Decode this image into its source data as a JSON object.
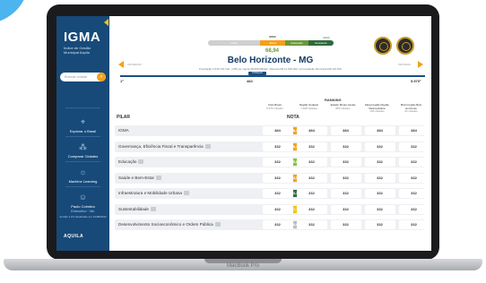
{
  "sidebar": {
    "logo": "IGMA",
    "subtitle": "Índice de Gestão Municipal Aquila",
    "search_placeholder": "Buscar cidade",
    "nav": [
      {
        "label": "Explorar o Brasil",
        "icon": "map-pin-icon",
        "glyph": "⌖"
      },
      {
        "label": "Comparar Cidades",
        "icon": "compare-icon",
        "glyph": "⁂"
      },
      {
        "label": "Machine Learning",
        "icon": "lightbulb-icon",
        "glyph": "☼"
      },
      {
        "label": "Paulo Coimbra",
        "sub": "Executivo · ML",
        "icon": "user-icon",
        "glyph": "☺"
      }
    ],
    "version": "Versão 1.0.0 Atualizado em 12/08/2022",
    "brand": "AQUILA"
  },
  "header": {
    "pill_title": "IGMA",
    "pill_marker": "IGMA",
    "pill_segments": [
      {
        "label": "Crítico",
        "color": "#cfcfcf"
      },
      {
        "label": "Alerta",
        "color": "#f2a11a"
      },
      {
        "label": "Adequado",
        "color": "#6a9a3a"
      },
      {
        "label": "Excelente",
        "color": "#2f6b3c"
      }
    ],
    "score": "68,94",
    "prev_label": "ANTERIOR",
    "next_label": "PRÓXIMA",
    "city": "Belo Horizonte - MG",
    "info": "População 2.530.701 hab.  |  PIB per capita 38.695 R$/hab  |  Receita R$ 11.530.000  |  Arrecadação Municipal R$ 123.500",
    "slider_label": "POSIÇÃO",
    "slider_min": "1º",
    "slider_pos": "484",
    "slider_max": "5.570º"
  },
  "table": {
    "ranking_label": "RANKING",
    "pilar_header": "PILAR",
    "nota_header": "NOTA",
    "columns": [
      {
        "title": "País Brasil",
        "sub": "5.570 cidades"
      },
      {
        "title": "Região Sudeste",
        "sub": "1.668 cidades"
      },
      {
        "title": "Estado Minas Gerais",
        "sub": "853 cidades"
      },
      {
        "title": "Mesorregião Região Metropolitana",
        "sub": "105 cidades"
      },
      {
        "title": "Microrregião Belo Horizonte",
        "sub": "24 cidades"
      }
    ],
    "rows": [
      {
        "label": "IGMA",
        "score": "68,4",
        "color": "#f2a11a",
        "ranks": [
          "484",
          "484",
          "484",
          "484",
          "484"
        ]
      },
      {
        "label": "Governança, Eficiência Fiscal e Transparência",
        "score": "66,3",
        "color": "#f2a11a",
        "ranks": [
          "332",
          "332",
          "332",
          "332",
          "332"
        ]
      },
      {
        "label": "Educação",
        "score": "70,6",
        "color": "#8cbf3f",
        "ranks": [
          "332",
          "332",
          "332",
          "332",
          "332"
        ]
      },
      {
        "label": "Saúde e Bem-Estar",
        "score": "64,5",
        "color": "#f2a11a",
        "ranks": [
          "332",
          "332",
          "332",
          "332",
          "332"
        ]
      },
      {
        "label": "Infraestrutura e Mobilidade Urbana",
        "score": "83,3",
        "color": "#2f6b3c",
        "ranks": [
          "332",
          "332",
          "332",
          "332",
          "332"
        ]
      },
      {
        "label": "Sustentabilidade",
        "score": "57,1",
        "color": "#f2c318",
        "ranks": [
          "332",
          "332",
          "332",
          "332",
          "332"
        ]
      },
      {
        "label": "Desenvolvimento Socioeconômico e Ordem Pública",
        "score": "48,8",
        "color": "#b9bcc2",
        "ranks": [
          "332",
          "332",
          "332",
          "332",
          "332"
        ]
      }
    ]
  },
  "device": {
    "label": "MacBook Pro"
  }
}
